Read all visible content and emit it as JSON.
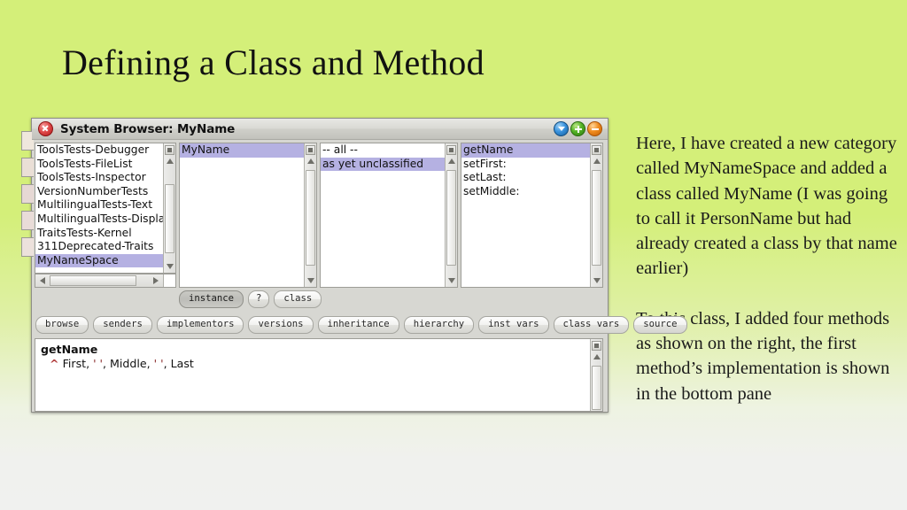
{
  "slide": {
    "title": "Defining a Class and Method"
  },
  "notes": {
    "paragraph1": "Here, I have created a new category called MyNameSpace and added a class called MyName (I was going to call it PersonName but had already created a class by that name earlier)",
    "paragraph2": "To this class, I added four methods as shown on the right, the first method’s implementation is shown in the bottom pane"
  },
  "window": {
    "title": "System Browser: MyName",
    "close_icon": "close-icon",
    "controls": [
      {
        "name": "collapse-button",
        "icon": "chevron-down-icon",
        "color": "#3a93dd"
      },
      {
        "name": "expand-button",
        "icon": "plus-icon",
        "color": "#54b325"
      },
      {
        "name": "minimize-button",
        "icon": "minus-icon",
        "color": "#f08b1d"
      }
    ]
  },
  "categories": {
    "items": [
      "ToolsTests-Debugger",
      "ToolsTests-FileList",
      "ToolsTests-Inspector",
      "VersionNumberTests",
      "MultilingualTests-Text",
      "MultilingualTests-Display",
      "TraitsTests-Kernel",
      "311Deprecated-Traits",
      "MyNameSpace"
    ],
    "selected": "MyNameSpace"
  },
  "classes": {
    "items": [
      "MyName"
    ],
    "selected": "MyName"
  },
  "protocols": {
    "items": [
      "-- all --",
      "as yet unclassified"
    ],
    "selected": "as yet unclassified"
  },
  "methods": {
    "items": [
      "getName",
      "setFirst:",
      "setLast:",
      "setMiddle:"
    ],
    "selected": "getName"
  },
  "switch_buttons": {
    "instance": "instance",
    "help": "?",
    "class": "class",
    "pressed": "instance"
  },
  "toolbar": {
    "buttons": [
      "browse",
      "senders",
      "implementors",
      "versions",
      "inheritance",
      "hierarchy",
      "inst vars",
      "class vars",
      "source"
    ]
  },
  "code": {
    "signature": "getName",
    "caret": "^",
    "body_before": " First, ",
    "string1": "' '",
    "body_mid1": ", Middle, ",
    "string2": "' '",
    "body_after": ", Last"
  },
  "colors": {
    "selection": "#b5b1e2",
    "background_top": "#d4ef79",
    "background_bottom": "#f0f1ef",
    "window_chrome": "#d7d7d2"
  }
}
